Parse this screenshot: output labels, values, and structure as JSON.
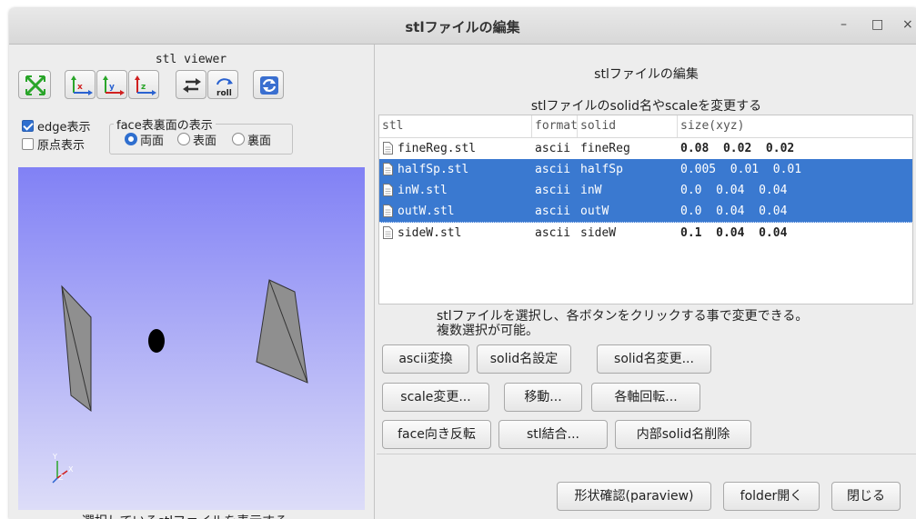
{
  "window": {
    "title": "stlファイルの編集",
    "minimize_label": "–",
    "maximize_label": "□",
    "close_label": "×"
  },
  "viewer": {
    "title": "stl viewer",
    "toolbar": [
      {
        "name": "fit-view-icon"
      },
      {
        "name": "view-x-axis-icon"
      },
      {
        "name": "view-y-axis-icon"
      },
      {
        "name": "view-z-axis-icon"
      },
      {
        "name": "reverse-view-icon"
      },
      {
        "name": "roll-icon",
        "label": "roll"
      },
      {
        "name": "reload-icon"
      }
    ],
    "edge_label": "edge表示",
    "edge_checked": true,
    "origin_label": "原点表示",
    "origin_checked": false,
    "face_group_title": "face表裏面の表示",
    "face_options": [
      "両面",
      "表面",
      "裏面"
    ],
    "face_selected": "両面",
    "axis_labels": {
      "y": "Y",
      "x": "X",
      "z": "Z"
    },
    "footer": "選択しているstlファイルを表示する。",
    "colors": {
      "bg_top": "#8181f5",
      "bg_bottom": "#ddddf8",
      "face": "#8f8f8f"
    }
  },
  "editor": {
    "header": "stlファイルの編集",
    "subheader": "stlファイルのsolid名やscaleを変更する",
    "columns": [
      "stl",
      "format",
      "solid",
      "size(xyz)"
    ],
    "rows": [
      {
        "stl": "fineReg.stl",
        "format": "ascii",
        "solid": "fineReg",
        "size": "0.08  0.02  0.02",
        "selected": false
      },
      {
        "stl": "halfSp.stl",
        "format": "ascii",
        "solid": "halfSp",
        "size": "0.005  0.01  0.01",
        "selected": true
      },
      {
        "stl": "inW.stl",
        "format": "ascii",
        "solid": "inW",
        "size": "0.0  0.04  0.04",
        "selected": true
      },
      {
        "stl": "outW.stl",
        "format": "ascii",
        "solid": "outW",
        "size": "0.0  0.04  0.04",
        "selected": true
      },
      {
        "stl": "sideW.stl",
        "format": "ascii",
        "solid": "sideW",
        "size": "0.1  0.04  0.04",
        "selected": false
      }
    ],
    "desc_line1": "stlファイルを選択し、各ボタンをクリックする事で変更できる。",
    "desc_line2": "複数選択が可能。",
    "buttons": {
      "ascii": "ascii変換",
      "set_solid": "solid名設定",
      "change_solid": "solid名変更...",
      "scale": "scale変更...",
      "move": "移動...",
      "rotate": "各軸回転...",
      "flip_face": "face向き反転",
      "merge": "stl結合...",
      "delete_inner": "内部solid名削除",
      "paraview": "形状確認(paraview)",
      "open_folder": "folder開く",
      "close": "閉じる"
    },
    "colors": {
      "selection": "#3a79d0",
      "accent": "#2f6fcf"
    }
  }
}
